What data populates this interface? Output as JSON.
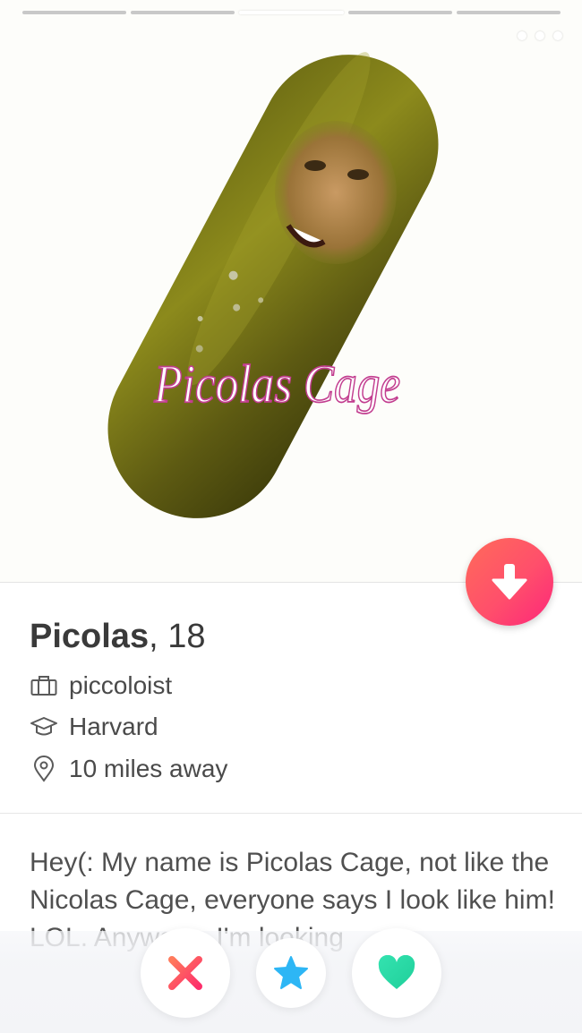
{
  "photo": {
    "progress_total": 5,
    "progress_active_index": 2,
    "caption_text": "Picolas Cage",
    "more_icon": "ellipsis-icon"
  },
  "profile": {
    "name": "Picolas",
    "separator": ",",
    "age": "18",
    "job": "piccoloist",
    "school": "Harvard",
    "distance": "10 miles away",
    "job_icon": "briefcase-icon",
    "school_icon": "graduation-cap-icon",
    "distance_icon": "location-pin-icon"
  },
  "bio": {
    "text": "Hey(: My name is Picolas Cage, not like the Nicolas Cage, everyone says I look like him! LOL. Anyways, I'm looking"
  },
  "actions": {
    "collapse_icon": "arrow-down-icon",
    "nope_icon": "x-icon",
    "super_like_icon": "star-icon",
    "like_icon": "heart-icon"
  },
  "colors": {
    "accent_gradient_start": "#ff6b5a",
    "accent_gradient_end": "#fd267a",
    "nope": "#fd5068",
    "super_like": "#2db6f5",
    "like": "#2be0a4"
  }
}
